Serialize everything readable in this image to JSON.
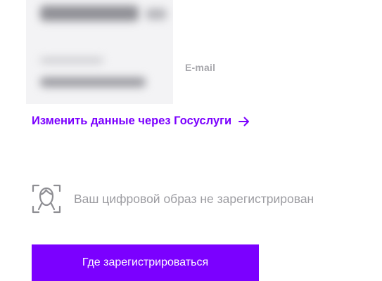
{
  "profile": {
    "email_label": "E-mail"
  },
  "gosuslugi": {
    "link_label": "Изменить данные через Госуслуги"
  },
  "biometry": {
    "status_text": "Ваш цифровой образ не зарегистрирован",
    "icon": "face-id-icon"
  },
  "actions": {
    "register_label": "Где зарегистрироваться"
  },
  "colors": {
    "accent": "#7b00ff",
    "muted_text": "#9c9ca1",
    "button_text": "#ffffff"
  }
}
